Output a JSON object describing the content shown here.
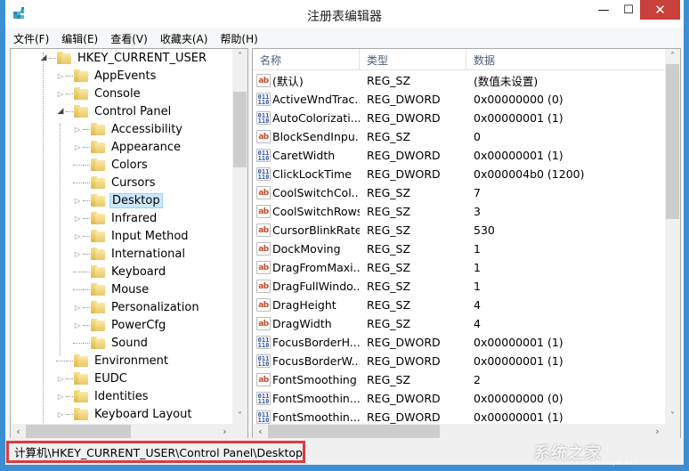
{
  "window": {
    "title": "注册表编辑器",
    "controls": {
      "minimize": "—",
      "maximize": "☐",
      "close": "✕"
    }
  },
  "menubar": {
    "items": [
      {
        "label": "文件(F)"
      },
      {
        "label": "编辑(E)"
      },
      {
        "label": "查看(V)"
      },
      {
        "label": "收藏夹(A)"
      },
      {
        "label": "帮助(H)"
      }
    ]
  },
  "tree": {
    "nodes": [
      {
        "label": "HKEY_CURRENT_USER",
        "level": 0,
        "expander": "open"
      },
      {
        "label": "AppEvents",
        "level": 1,
        "expander": "closed"
      },
      {
        "label": "Console",
        "level": 1,
        "expander": "closed"
      },
      {
        "label": "Control Panel",
        "level": 1,
        "expander": "open"
      },
      {
        "label": "Accessibility",
        "level": 2,
        "expander": "closed"
      },
      {
        "label": "Appearance",
        "level": 2,
        "expander": "closed"
      },
      {
        "label": "Colors",
        "level": 2,
        "expander": "none"
      },
      {
        "label": "Cursors",
        "level": 2,
        "expander": "none"
      },
      {
        "label": "Desktop",
        "level": 2,
        "expander": "closed",
        "selected": true
      },
      {
        "label": "Infrared",
        "level": 2,
        "expander": "closed"
      },
      {
        "label": "Input Method",
        "level": 2,
        "expander": "closed"
      },
      {
        "label": "International",
        "level": 2,
        "expander": "closed"
      },
      {
        "label": "Keyboard",
        "level": 2,
        "expander": "none"
      },
      {
        "label": "Mouse",
        "level": 2,
        "expander": "none"
      },
      {
        "label": "Personalization",
        "level": 2,
        "expander": "closed"
      },
      {
        "label": "PowerCfg",
        "level": 2,
        "expander": "closed"
      },
      {
        "label": "Sound",
        "level": 2,
        "expander": "none"
      },
      {
        "label": "Environment",
        "level": 1,
        "expander": "none"
      },
      {
        "label": "EUDC",
        "level": 1,
        "expander": "closed"
      },
      {
        "label": "Identities",
        "level": 1,
        "expander": "closed"
      },
      {
        "label": "Keyboard Layout",
        "level": 1,
        "expander": "closed"
      }
    ],
    "scroll": {
      "vertical_position": 0.08,
      "vertical_visible_fraction": 0.22,
      "horizontal_visible_fraction": 0.55
    }
  },
  "list": {
    "columns": {
      "name": "名称",
      "type": "类型",
      "data": "数据"
    },
    "rows": [
      {
        "name": "(默认)",
        "type": "REG_SZ",
        "data": "(数值未设置)",
        "icon": "string"
      },
      {
        "name": "ActiveWndTrac...",
        "type": "REG_DWORD",
        "data": "0x00000000 (0)",
        "icon": "dword"
      },
      {
        "name": "AutoColorizati...",
        "type": "REG_DWORD",
        "data": "0x00000001 (1)",
        "icon": "dword"
      },
      {
        "name": "BlockSendInpu...",
        "type": "REG_SZ",
        "data": "0",
        "icon": "string"
      },
      {
        "name": "CaretWidth",
        "type": "REG_DWORD",
        "data": "0x00000001 (1)",
        "icon": "dword"
      },
      {
        "name": "ClickLockTime",
        "type": "REG_DWORD",
        "data": "0x000004b0 (1200)",
        "icon": "dword"
      },
      {
        "name": "CoolSwitchCol...",
        "type": "REG_SZ",
        "data": "7",
        "icon": "string"
      },
      {
        "name": "CoolSwitchRows",
        "type": "REG_SZ",
        "data": "3",
        "icon": "string"
      },
      {
        "name": "CursorBlinkRate",
        "type": "REG_SZ",
        "data": "530",
        "icon": "string"
      },
      {
        "name": "DockMoving",
        "type": "REG_SZ",
        "data": "1",
        "icon": "string"
      },
      {
        "name": "DragFromMaxi...",
        "type": "REG_SZ",
        "data": "1",
        "icon": "string"
      },
      {
        "name": "DragFullWindo...",
        "type": "REG_SZ",
        "data": "1",
        "icon": "string"
      },
      {
        "name": "DragHeight",
        "type": "REG_SZ",
        "data": "4",
        "icon": "string"
      },
      {
        "name": "DragWidth",
        "type": "REG_SZ",
        "data": "4",
        "icon": "string"
      },
      {
        "name": "FocusBorderH...",
        "type": "REG_DWORD",
        "data": "0x00000001 (1)",
        "icon": "dword"
      },
      {
        "name": "FocusBorderW...",
        "type": "REG_DWORD",
        "data": "0x00000001 (1)",
        "icon": "dword"
      },
      {
        "name": "FontSmoothing",
        "type": "REG_SZ",
        "data": "2",
        "icon": "string"
      },
      {
        "name": "FontSmoothin...",
        "type": "REG_DWORD",
        "data": "0x00000000 (0)",
        "icon": "dword"
      },
      {
        "name": "FontSmoothin...",
        "type": "REG_DWORD",
        "data": "0x00000001 (1)",
        "icon": "dword"
      }
    ],
    "icon_text": {
      "string": "ab",
      "dword_top": "011",
      "dword_bottom": "110"
    },
    "scroll": {
      "vertical_position": 0.0,
      "vertical_visible_fraction": 0.45,
      "horizontal_visible_fraction": 0.45
    }
  },
  "statusbar": {
    "path": "计算机\\HKEY_CURRENT_USER\\Control Panel\\Desktop"
  },
  "watermark": {
    "text": "系统之家",
    "sub": "XITONGZHIJIA.NET"
  },
  "colors": {
    "accent_border": "#3c8ed3",
    "close_button": "#c7403a",
    "selection_bg": "#cce8ff",
    "status_highlight": "#e0393e"
  }
}
